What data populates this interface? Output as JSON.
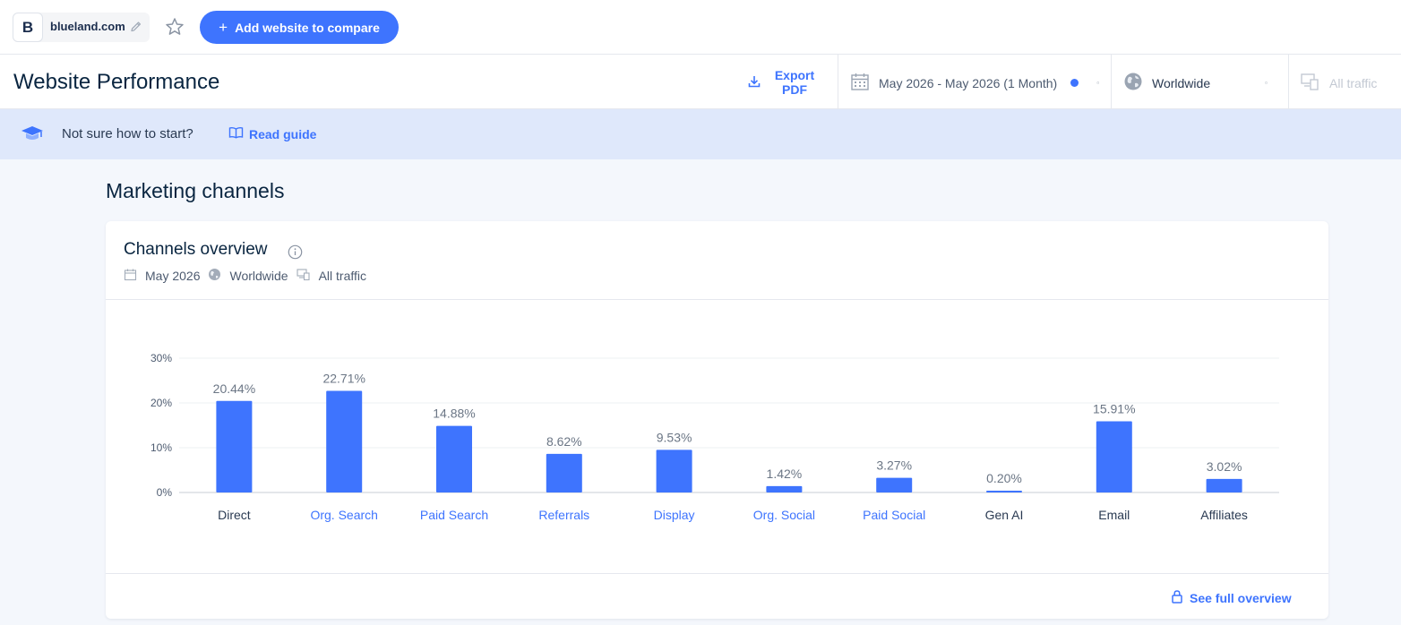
{
  "topbar": {
    "site_logo_letter": "B",
    "site_name": "blueland.com",
    "add_button_label": "Add website to compare",
    "add_button_icon": "plus-icon",
    "favorite_icon": "star-icon",
    "edit_icon": "pencil-icon"
  },
  "header": {
    "title": "Website Performance",
    "export_label": "Export PDF",
    "date_range": "May 2026 - May 2026 (1 Month)",
    "country": "Worldwide",
    "traffic": "All traffic"
  },
  "banner": {
    "text": "Not sure how to start?",
    "link": "Read guide"
  },
  "section": {
    "title": "Marketing channels"
  },
  "card": {
    "title": "Channels overview",
    "meta_date": "May 2026",
    "meta_geo": "Worldwide",
    "meta_traffic": "All traffic",
    "footer_link": "See full overview"
  },
  "colors": {
    "accent": "#3e74fe",
    "bar": "#3e74fe",
    "text_dark": "#092540",
    "banner_bg": "#dfe8fb"
  },
  "chart_data": {
    "type": "bar",
    "title": "",
    "categories": [
      "Direct",
      "Org. Search",
      "Paid Search",
      "Referrals",
      "Display",
      "Org. Social",
      "Paid Social",
      "Gen AI",
      "Email",
      "Affiliates"
    ],
    "category_links": [
      false,
      true,
      true,
      true,
      true,
      true,
      true,
      false,
      false,
      false
    ],
    "values": [
      20.44,
      22.71,
      14.88,
      8.62,
      9.53,
      1.42,
      3.27,
      0.2,
      15.91,
      3.02
    ],
    "value_labels": [
      "20.44%",
      "22.71%",
      "14.88%",
      "8.62%",
      "9.53%",
      "1.42%",
      "3.27%",
      "0.20%",
      "15.91%",
      "3.02%"
    ],
    "y_ticks": [
      0,
      10,
      20,
      30
    ],
    "y_tick_labels": [
      "0%",
      "10%",
      "20%",
      "30%"
    ],
    "ylim": [
      0,
      30
    ],
    "xlabel": "",
    "ylabel": "",
    "grid": true,
    "legend": "none"
  }
}
